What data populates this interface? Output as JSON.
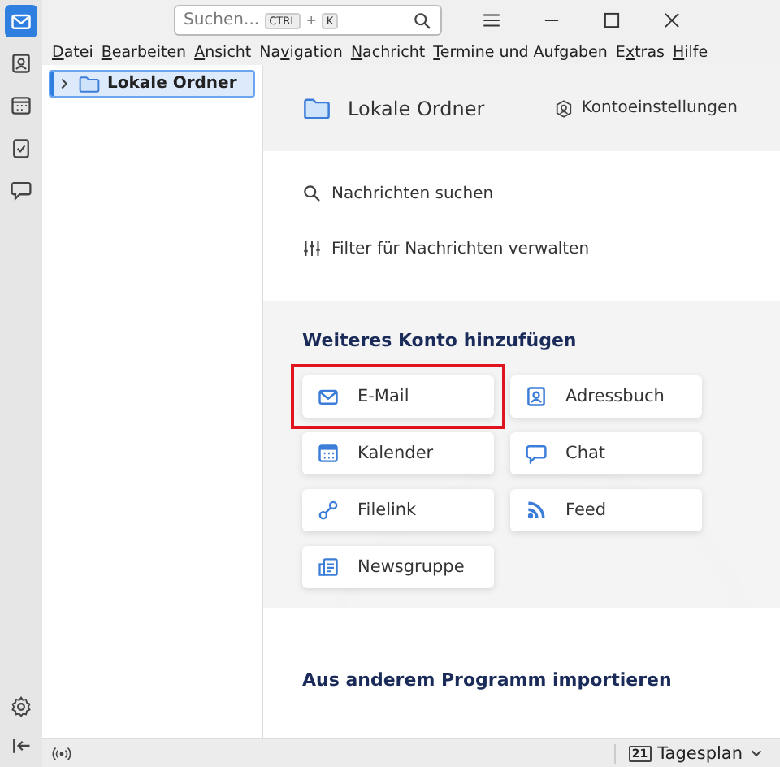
{
  "search": {
    "placeholder": "Suchen...",
    "shortcut": [
      "CTRL",
      "+",
      "K"
    ]
  },
  "menu": [
    {
      "key": "D",
      "post": "atei"
    },
    {
      "key": "B",
      "post": "earbeiten"
    },
    {
      "key": "A",
      "post": "nsicht"
    },
    {
      "pre": "Na",
      "key": "v",
      "post": "igation"
    },
    {
      "key": "N",
      "post": "achricht"
    },
    {
      "key": "T",
      "post": "ermine und Aufgaben"
    },
    {
      "pre": "E",
      "key": "x",
      "post": "tras"
    },
    {
      "key": "H",
      "post": "ilfe"
    }
  ],
  "spaces": [
    {
      "kind": "mail",
      "selected": true
    },
    {
      "kind": "addressbook",
      "selected": false
    },
    {
      "kind": "calendar",
      "selected": false
    },
    {
      "kind": "tasks",
      "selected": false
    },
    {
      "kind": "chat",
      "selected": false
    }
  ],
  "folder_tree": [
    {
      "label": "Lokale Ordner",
      "selected": true,
      "expanded": false
    }
  ],
  "header": {
    "title": "Lokale Ordner",
    "settings": "Kontoeinstellungen"
  },
  "actions": [
    {
      "kind": "search",
      "label": "Nachrichten suchen"
    },
    {
      "kind": "filter",
      "label": "Filter für Nachrichten verwalten"
    }
  ],
  "add_account": {
    "heading": "Weiteres Konto hinzufügen",
    "buttons": [
      {
        "kind": "mail",
        "label": "E-Mail",
        "highlighted": true
      },
      {
        "kind": "addressbook",
        "label": "Adressbuch",
        "highlighted": false
      },
      {
        "kind": "calendar",
        "label": "Kalender",
        "highlighted": false
      },
      {
        "kind": "chat",
        "label": "Chat",
        "highlighted": false
      },
      {
        "kind": "filelink",
        "label": "Filelink",
        "highlighted": false
      },
      {
        "kind": "feed",
        "label": "Feed",
        "highlighted": false
      },
      {
        "kind": "newsgroup",
        "label": "Newsgruppe",
        "highlighted": false
      }
    ]
  },
  "import": {
    "heading": "Aus anderem Programm importieren"
  },
  "status_bar": {
    "today": "Tagesplan",
    "calendar_day": "21"
  }
}
